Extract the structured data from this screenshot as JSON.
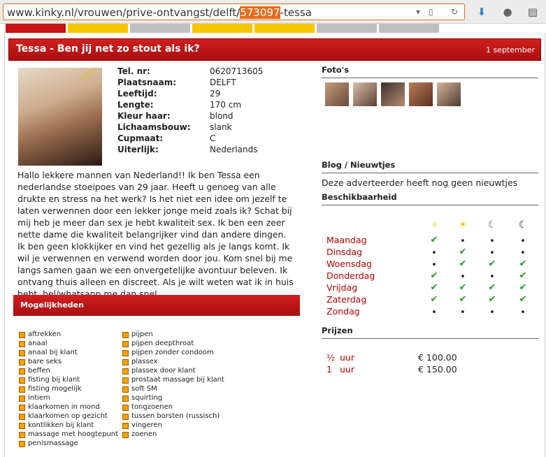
{
  "browser": {
    "url_prefix": "www.kinky.nl/vrouwen/prive-ontvangst/delft/",
    "url_highlight": "573097",
    "url_suffix": "-tessa"
  },
  "tabs": [
    {
      "color": "#c81414"
    },
    {
      "color": "#f6c600"
    },
    {
      "color": "#bfbfbf"
    },
    {
      "color": "#f6c600"
    },
    {
      "color": "#f6c600"
    },
    {
      "color": "#bfbfbf"
    },
    {
      "color": "#bfbfbf"
    }
  ],
  "header": {
    "title": "Tessa - Ben jij net zo stout als ik?",
    "date": "1 september"
  },
  "profile": [
    {
      "key": "Tel. nr:",
      "value": "0620713605"
    },
    {
      "key": "Plaatsnaam:",
      "value": "DELFT"
    },
    {
      "key": "Leeftijd:",
      "value": "29"
    },
    {
      "key": "Lengte:",
      "value": "170 cm"
    },
    {
      "key": "Kleur haar:",
      "value": "blond"
    },
    {
      "key": "Lichaamsbouw:",
      "value": "slank"
    },
    {
      "key": "Cupmaat:",
      "value": "C"
    },
    {
      "key": "Uiterlijk:",
      "value": "Nederlands"
    }
  ],
  "description": "Hallo lekkere mannen van Nederland!! Ik ben Tessa een nederlandse stoeipoes van 29 jaar. Heeft u genoeg van alle drukte en stress na het werk? Is het niet een idee om jezelf te laten verwennen door een lekker jonge meid zoals ik? Schat bij mij heb je meer dan sex je hebt kwaliteit sex. Ik ben een zeer nette dame die kwaliteit belangrijker vind dan andere dingen. Ik ben geen klokkijker en vind het gezellig als je langs komt. Ik wil je verwennen en verwend worden door jou. Kom snel bij me langs samen gaan we een onvergetelijke avontuur beleven. Ik ontvang thuis alleen en discreet. Als je wilt weten wat ik in huis hebt, bel/whatsapp me dan snel",
  "mogelijkheden": {
    "title": "Mogelijkheden",
    "col1": [
      "aftrekken",
      "anaal",
      "anaal bij klant",
      "bare seks",
      "beffen",
      "fisting bij klant",
      "fisting mogelijk",
      "intiem",
      "klaarkomen in mond",
      "klaarkomen op gezicht",
      "kontlikken bij klant",
      "massage met hoogtepunt",
      "penismassage"
    ],
    "col2": [
      "pijpen",
      "pijpen deepthroat",
      "pijpen zonder condoom",
      "plassex",
      "plassex door klant",
      "prostaat massage bij klant",
      "soft SM",
      "squirting",
      "tongzoenen",
      "tussen borsten (russisch)",
      "vingeren",
      "zoenen"
    ]
  },
  "photo_stamp": "Kinky.nl",
  "sections": {
    "photos": "Foto's",
    "blog": "Blog / Nieuwtjes",
    "blog_text": "Deze adverteerder heeft nog geen nieuwtjes",
    "availability": "Beschikbaarheid",
    "prices": "Prijzen"
  },
  "availability": {
    "days": [
      {
        "day": "Maandag",
        "slots": [
          1,
          0,
          0,
          0
        ]
      },
      {
        "day": "Dinsdag",
        "slots": [
          0,
          1,
          0,
          0
        ]
      },
      {
        "day": "Woensdag",
        "slots": [
          0,
          1,
          1,
          1
        ]
      },
      {
        "day": "Donderdag",
        "slots": [
          1,
          0,
          0,
          1
        ]
      },
      {
        "day": "Vrijdag",
        "slots": [
          1,
          1,
          1,
          1
        ]
      },
      {
        "day": "Zaterdag",
        "slots": [
          1,
          1,
          1,
          1
        ]
      },
      {
        "day": "Zondag",
        "slots": [
          0,
          0,
          0,
          0
        ]
      }
    ],
    "icons": [
      "morning-sun-icon",
      "afternoon-sun-icon",
      "evening-moon-icon",
      "night-moon-icon"
    ]
  },
  "prices": [
    {
      "qty": "½",
      "unit": "uur",
      "price": "€ 100.00"
    },
    {
      "qty": "1",
      "unit": "uur",
      "price": "€ 150.00"
    }
  ]
}
